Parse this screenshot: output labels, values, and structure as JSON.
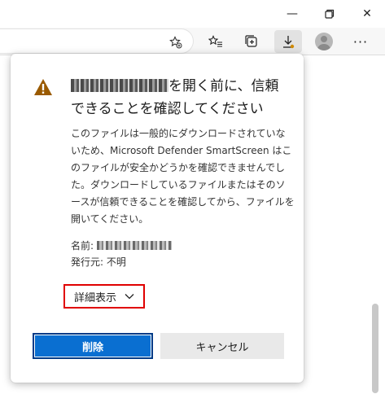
{
  "window": {
    "minimize_icon": "minimize-icon",
    "maximize_icon": "restore-icon",
    "close_icon": "close-icon",
    "minimize_glyph": "—",
    "close_glyph": "✕"
  },
  "toolbar": {
    "more_glyph": "···"
  },
  "dialog": {
    "title_suffix": "を開く前に、信頼できることを確認してください",
    "description": "このファイルは一般的にダウンロードされていないため、Microsoft Defender SmartScreen はこのファイルが安全かどうかを確認できませんでした。ダウンロードしているファイルまたはそのソースが信頼できることを確認してから、ファイルを開いてください。",
    "name_label": "名前:",
    "publisher_label": "発行元:",
    "publisher_value": "不明",
    "details_label": "詳細表示",
    "delete_label": "削除",
    "cancel_label": "キャンセル"
  },
  "colors": {
    "accent": "#0a6fd1",
    "warning": "#9a5a00",
    "highlight_border": "#e00000"
  }
}
